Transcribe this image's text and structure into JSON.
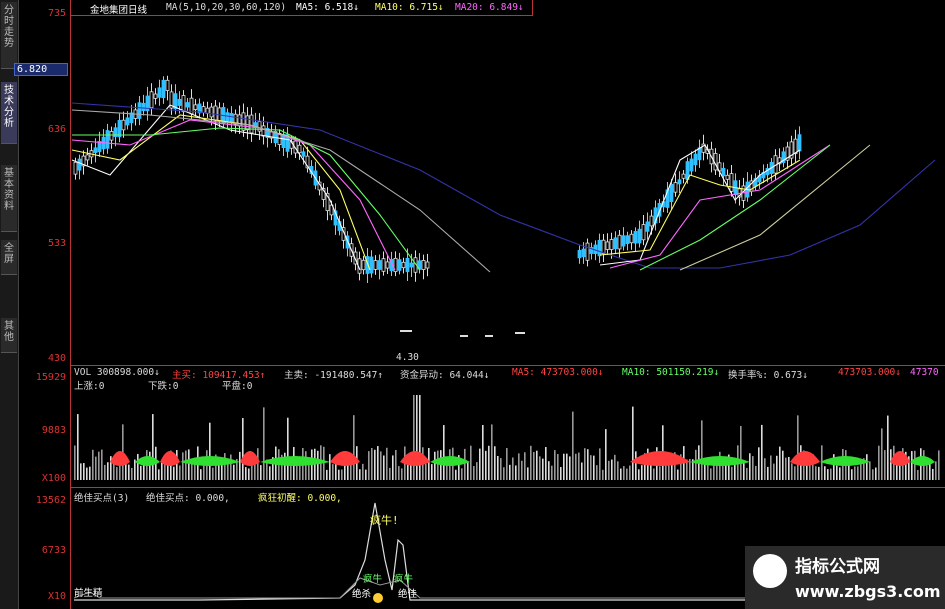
{
  "sidebar": {
    "tabs": [
      {
        "label": "分时走势",
        "active": false
      },
      {
        "label": "技术分析",
        "active": true
      },
      {
        "label": "基本资料",
        "active": false
      },
      {
        "label": "全屏",
        "active": false
      },
      {
        "label": "其他",
        "active": false
      }
    ]
  },
  "price_axis": {
    "labels": [
      "735",
      "636",
      "533",
      "430"
    ],
    "current_price": "6.820"
  },
  "volume_axis": {
    "labels": [
      "15929",
      "9883",
      "X100"
    ]
  },
  "indicator_axis": {
    "labels": [
      "13562",
      "6733",
      "X10"
    ]
  },
  "header": {
    "stock_name": "金地集团日线",
    "ma_params": "MA(5,10,20,30,60,120)",
    "ma5": "MA5: 6.518↓",
    "ma10": "MA10: 6.715↓",
    "ma20": "MA20: 6.849↓"
  },
  "volume_header": {
    "vol": "VOL 300898.000↓",
    "zhumai": "主买: 109417.453↑",
    "zhumai2": "主卖: -191480.547↑",
    "zijin": "资金异动: 64.044↓",
    "ma5": "MA5: 473703.000↓",
    "ma10": "MA10: 501150.219↓",
    "huanshou": "换手率%: 0.673↓",
    "ma_last": "473703.000↓",
    "ma_last2": "47370",
    "shangzhang": "上涨:0",
    "xiadie": "下跌:0",
    "pingpan": "平盘:0"
  },
  "indicator_header": {
    "title": "绝佳买点(3)",
    "value": "绝佳买点: 0.000,",
    "label2": "疯狂初醒: 0.000,"
  },
  "annotations": {
    "low_price": "4.30",
    "fengniu": "疯牛!",
    "fengniu_small": "疯牛",
    "jueshi": "绝杀",
    "jueshi2": "绝佳",
    "bull_left": "前生精"
  },
  "watermark": {
    "title": "指标公式网",
    "url": "www.zbgs3.com"
  },
  "colors": {
    "axis": "#b33",
    "up": "#ff3b3b",
    "down": "#30c0ff",
    "ma5": "#ffffff",
    "ma10": "#ffff66",
    "ma20": "#ff66ff",
    "ma30": "#66ff66",
    "ma60": "#aaaaaa",
    "ma120": "#3333aa"
  }
}
